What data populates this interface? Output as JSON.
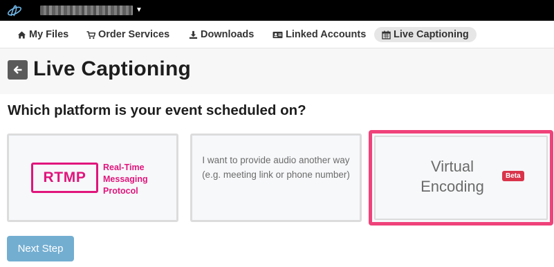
{
  "topbar": {
    "logo_icon": "atom-logo-icon",
    "account_name": "",
    "account_caret_icon": "caret-down-icon"
  },
  "nav": {
    "items": [
      {
        "label": "My Files",
        "icon": "home-icon"
      },
      {
        "label": "Order Services",
        "icon": "cart-icon"
      },
      {
        "label": "Downloads",
        "icon": "download-icon"
      },
      {
        "label": "Linked Accounts",
        "icon": "id-card-icon"
      },
      {
        "label": "Live Captioning",
        "icon": "calendar-icon",
        "active": true
      }
    ]
  },
  "header": {
    "back_icon": "arrow-left-icon",
    "title": "Live Captioning"
  },
  "question": "Which platform is your event scheduled on?",
  "options": {
    "rtmp": {
      "badge": "RTMP",
      "description": "Real-Time\nMessaging\nProtocol"
    },
    "other": {
      "text": "I want to provide audio another way (e.g. meeting link or phone number)"
    },
    "virtual": {
      "text": "Virtual\nEncoding",
      "badge": "Beta",
      "selected": true
    }
  },
  "next_button": {
    "label": "Next Step"
  },
  "colors": {
    "accent_pink": "#e0157c",
    "selected_border": "#f0427a",
    "beta_badge": "#d9344a",
    "next_button": "#73aed1"
  }
}
